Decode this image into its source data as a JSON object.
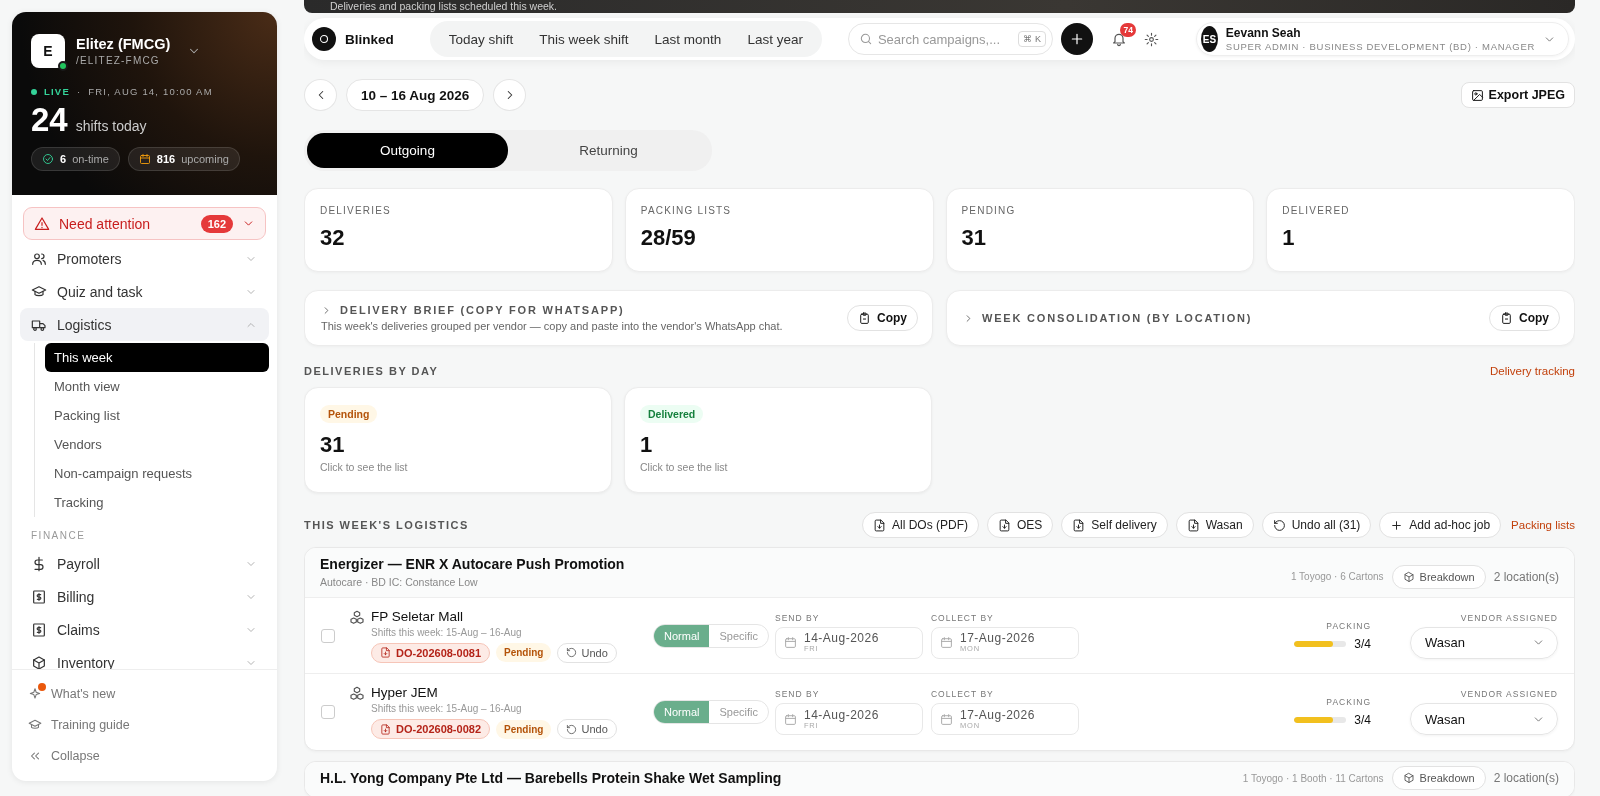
{
  "banner": {
    "text": "Deliveries and packing lists scheduled this week."
  },
  "sidebar": {
    "org": {
      "initial": "E",
      "name": "Elitez (FMCG)",
      "slug": "/ELITEZ-FMCG",
      "online": true
    },
    "live": {
      "label": "LIVE",
      "separator": "·",
      "datetime": "FRI, AUG 14, 10:00 AM"
    },
    "shifts": {
      "count": "24",
      "label": "shifts today"
    },
    "chips": [
      {
        "kind": "ontime",
        "value": "6",
        "label": "on-time"
      },
      {
        "kind": "upcoming",
        "value": "816",
        "label": "upcoming"
      }
    ],
    "attention": {
      "label": "Need attention",
      "count": "162",
      "expanded": false
    },
    "nav": [
      {
        "kind": "item",
        "label": "Promoters",
        "expanded": false
      },
      {
        "kind": "item",
        "label": "Quiz and task",
        "expanded": false
      },
      {
        "kind": "item",
        "label": "Logistics",
        "expanded": true,
        "children": [
          {
            "label": "This week",
            "selected": true
          },
          {
            "label": "Month view",
            "selected": false
          },
          {
            "label": "Packing list",
            "selected": false
          },
          {
            "label": "Vendors",
            "selected": false
          },
          {
            "label": "Non-campaign requests",
            "selected": false
          },
          {
            "label": "Tracking",
            "selected": false
          }
        ]
      },
      {
        "kind": "section",
        "label": "FINANCE"
      },
      {
        "kind": "item",
        "label": "Payroll",
        "expanded": false
      },
      {
        "kind": "item",
        "label": "Billing",
        "expanded": false
      },
      {
        "kind": "item",
        "label": "Claims",
        "expanded": false
      },
      {
        "kind": "item",
        "label": "Inventory",
        "expanded": false
      }
    ],
    "footer": [
      {
        "label": "What's new",
        "unread": true
      },
      {
        "label": "Training guide",
        "unread": false
      },
      {
        "label": "Collapse",
        "unread": false
      }
    ]
  },
  "topbar": {
    "brand": "Blinked",
    "ranges": [
      {
        "label": "Today shift",
        "selected": false
      },
      {
        "label": "This week shift",
        "selected": false
      },
      {
        "label": "Last month",
        "selected": false
      },
      {
        "label": "Last year",
        "selected": false
      }
    ],
    "search": {
      "placeholder": "Search campaigns,...",
      "shortcut": "⌘ K"
    },
    "notifications": "74",
    "user": {
      "initials": "ES",
      "name": "Eevann Seah",
      "role": "SUPER ADMIN · BUSINESS DEVELOPMENT (BD) · MANAGER"
    }
  },
  "period": {
    "label": "10 – 16 Aug 2026",
    "export": "Export JPEG"
  },
  "direction_tabs": [
    {
      "label": "Outgoing",
      "selected": true
    },
    {
      "label": "Returning",
      "selected": false
    }
  ],
  "stats": [
    {
      "label": "DELIVERIES",
      "value": "32"
    },
    {
      "label": "PACKING LISTS",
      "value": "28/59"
    },
    {
      "label": "PENDING",
      "value": "31"
    },
    {
      "label": "DELIVERED",
      "value": "1"
    }
  ],
  "briefs": [
    {
      "title": "DELIVERY BRIEF (COPY FOR WHATSAPP)",
      "description": "This week's deliveries grouped per vendor — copy and paste into the vendor's WhatsApp chat.",
      "expanded": false,
      "action": "Copy"
    },
    {
      "title": "WEEK CONSOLIDATION (BY LOCATION)",
      "expanded": false,
      "action": "Copy"
    }
  ],
  "by_day": {
    "heading": "DELIVERIES BY DAY",
    "link": "Delivery tracking",
    "cards": [
      {
        "kind": "pending",
        "status": "Pending",
        "count": "31",
        "hint": "Click to see the list"
      },
      {
        "kind": "delivered",
        "status": "Delivered",
        "count": "1",
        "hint": "Click to see the list"
      }
    ]
  },
  "logistics": {
    "heading": "THIS WEEK'S LOGISTICS",
    "actions": [
      {
        "kind": "download",
        "label": "All DOs (PDF)"
      },
      {
        "kind": "download",
        "label": "OES"
      },
      {
        "kind": "download",
        "label": "Self delivery"
      },
      {
        "kind": "download",
        "label": "Wasan"
      },
      {
        "kind": "undo",
        "label": "Undo all (31)"
      },
      {
        "kind": "add",
        "label": "Add ad-hoc job"
      }
    ],
    "link": "Packing lists",
    "groups": [
      {
        "title": "Energizer — ENR X Autocare Push Promotion",
        "subtitle": "Autocare · BD IC: Constance Low",
        "summary": "1 Toyogo · 6 Cartons",
        "breakdown": "Breakdown",
        "locations": "2 location(s)",
        "rows": [
          {
            "checked": false,
            "name": "FP Seletar Mall",
            "shifts": "Shifts this week: 15-Aug – 16-Aug",
            "do_number": "DO-202608-0081",
            "status": "Pending",
            "undo": "Undo",
            "modes": [
              {
                "label": "Normal",
                "selected": true
              },
              {
                "label": "Specific",
                "selected": false
              }
            ],
            "send_label": "SEND BY",
            "send_date": "14-Aug-2026",
            "send_day": "FRI",
            "collect_label": "COLLECT BY",
            "collect_date": "17-Aug-2026",
            "collect_day": "MON",
            "packing_label": "PACKING",
            "level": 0.75,
            "packing": "3/4",
            "vendor_label": "VENDOR ASSIGNED",
            "vendor": "Wasan"
          },
          {
            "checked": false,
            "name": "Hyper JEM",
            "shifts": "Shifts this week: 15-Aug – 16-Aug",
            "do_number": "DO-202608-0082",
            "status": "Pending",
            "undo": "Undo",
            "modes": [
              {
                "label": "Normal",
                "selected": true
              },
              {
                "label": "Specific",
                "selected": false
              }
            ],
            "send_label": "SEND BY",
            "send_date": "14-Aug-2026",
            "send_day": "FRI",
            "collect_label": "COLLECT BY",
            "collect_date": "17-Aug-2026",
            "collect_day": "MON",
            "packing_label": "PACKING",
            "level": 0.75,
            "packing": "3/4",
            "vendor_label": "VENDOR ASSIGNED",
            "vendor": "Wasan"
          }
        ]
      },
      {
        "title": "H.L. Yong Company Pte Ltd — Barebells Protein Shake Wet Sampling",
        "summary": "1 Toyogo · 1 Booth · 11 Cartons",
        "breakdown": "Breakdown",
        "locations": "2 location(s)"
      }
    ]
  }
}
